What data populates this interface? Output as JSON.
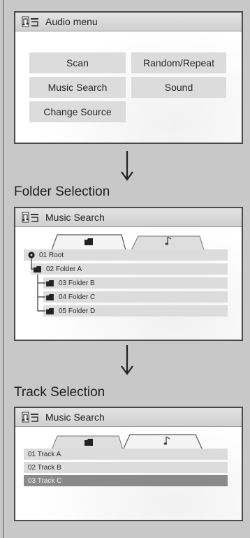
{
  "audio_menu": {
    "title": "Audio menu",
    "buttons": {
      "scan": "Scan",
      "random_repeat": "Random/Repeat",
      "music_search": "Music Search",
      "sound": "Sound",
      "change_source": "Change Source"
    }
  },
  "folder_selection": {
    "label": "Folder Selection",
    "title": "Music Search",
    "items": [
      "01 Root",
      "02 Folder A",
      "03 Folder B",
      "04 Folder C",
      "05 Folder D"
    ]
  },
  "track_selection": {
    "label": "Track Selection",
    "title": "Music Search",
    "items": [
      "01 Track A",
      "02 Track B",
      "03 Track C"
    ],
    "selected_index": 2
  },
  "icons": {
    "title": "audio-source-icon",
    "folder_tab": "folder-icon",
    "track_tab": "music-note-icon",
    "arrow": "arrow-down-icon",
    "root": "root-disc-icon"
  },
  "colors": {
    "frame": "#4a4a4a",
    "button": "#dcdcdc",
    "selected_row": "#8a8a8a",
    "background": "#c8c8c8"
  }
}
